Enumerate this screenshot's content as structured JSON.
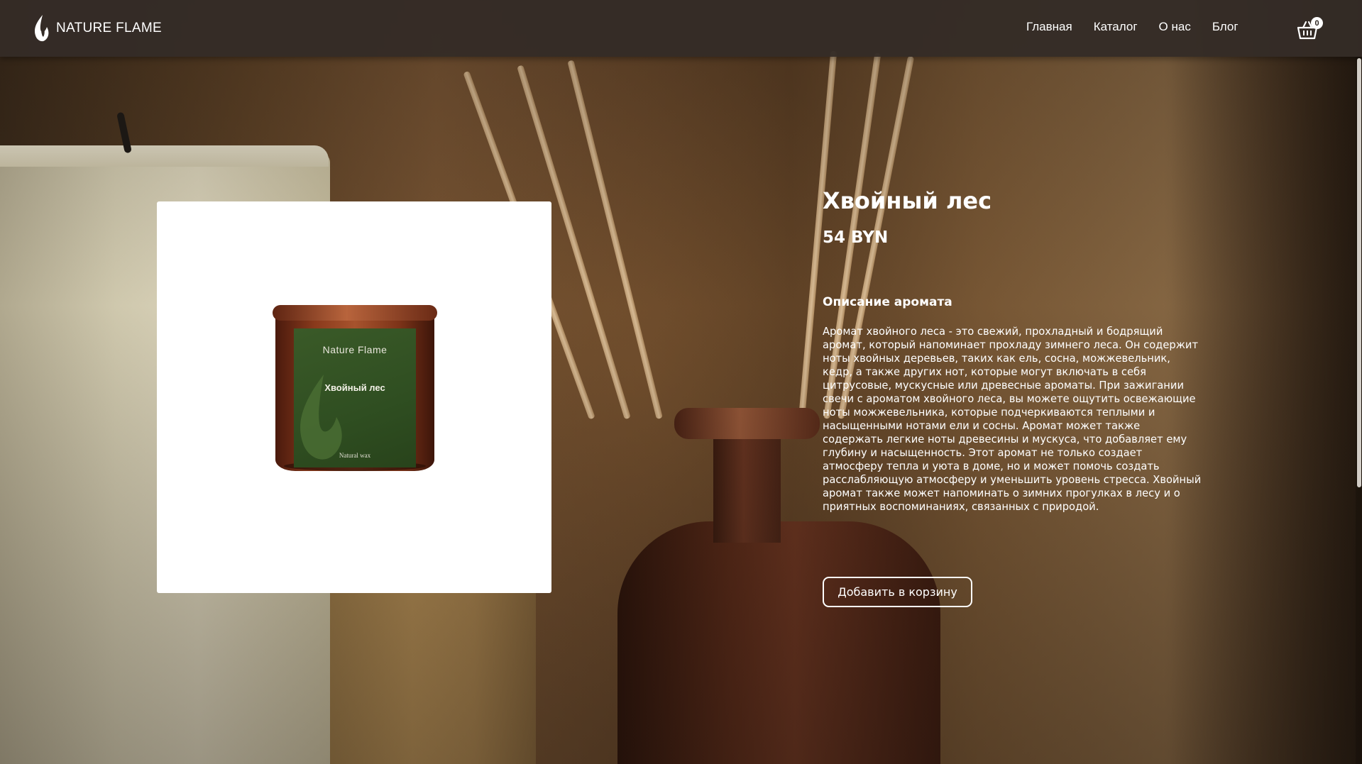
{
  "header": {
    "logo_text": "NATURE FLAME",
    "nav": [
      "Главная",
      "Каталог",
      "О нас",
      "Блог"
    ],
    "cart_count": "0"
  },
  "product": {
    "title": "Хвойный лес",
    "price": "54 BYN",
    "description_heading": "Описание аромата",
    "description": "Аромат хвойного леса - это свежий, прохладный и бодрящий аромат, который напоминает прохладу зимнего леса. Он содержит ноты хвойных деревьев, таких как ель, сосна, можжевельник, кедр, а также других нот, которые могут включать в себя цитрусовые, мускусные или древесные ароматы. При зажигании свечи с ароматом хвойного леса, вы можете ощутить освежающие ноты можжевельника, которые подчеркиваются теплыми и насыщенными нотами ели и сосны. Аромат может также содержать легкие ноты древесины и мускуса, что добавляет ему глубину и насыщенность. Этот аромат не только создает атмосферу тепла и уюта в доме, но и может помочь создать расслабляющую атмосферу и уменьшить уровень стресса. Хвойный аромат также может напоминать о зимних прогулках в лесу и о приятных воспоминаниях, связанных с природой.",
    "add_to_cart_label": "Добавить в корзину",
    "image_label": {
      "brand": "Nature Flame",
      "name": "Хвойный лес",
      "wax": "Natural wax"
    }
  },
  "colors": {
    "header_bg": "#342c26",
    "label_green": "#2f4e21",
    "jar_amber": "#8a3a1c"
  },
  "icons": {
    "logo": "flame-icon",
    "cart": "shopping-basket-icon"
  }
}
